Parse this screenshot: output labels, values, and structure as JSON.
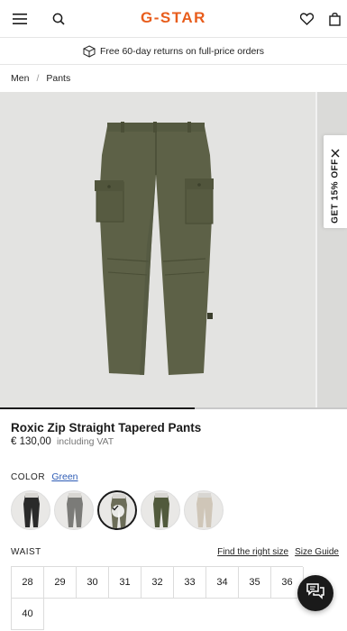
{
  "header": {
    "logo_text": "G-STAR",
    "icons": [
      "menu-icon",
      "search-icon",
      "heart-icon",
      "bag-icon"
    ],
    "brand_color": "#e85d1c"
  },
  "promo": {
    "text": "Free 60-day returns on full-price orders",
    "icon": "box-icon"
  },
  "breadcrumb": {
    "items": [
      "Men",
      "Pants"
    ],
    "separator": "/"
  },
  "gallery": {
    "progress": 0.56
  },
  "side_tab": {
    "label": "GET 15% OFF",
    "icon": "close-icon"
  },
  "product": {
    "title": "Roxic Zip Straight Tapered Pants",
    "price": "€ 130,00",
    "vat_note": "including VAT"
  },
  "color": {
    "label": "COLOR",
    "selected_value": "Green",
    "swatches": [
      {
        "name": "black",
        "fill": "#2a2a2a",
        "selected": false
      },
      {
        "name": "grey",
        "fill": "#7b7b78",
        "selected": false
      },
      {
        "name": "olive-light",
        "fill": "#6c6d58",
        "selected": true
      },
      {
        "name": "green",
        "fill": "#515a3c",
        "selected": false
      },
      {
        "name": "beige",
        "fill": "#cfc6b8",
        "selected": false
      }
    ]
  },
  "waist": {
    "label": "WAIST",
    "fit_link": "Find the right size",
    "guide_link": "Size Guide",
    "sizes": [
      "28",
      "29",
      "30",
      "31",
      "32",
      "33",
      "34",
      "35",
      "36",
      "40"
    ]
  },
  "chat": {
    "icon": "chat-icon"
  }
}
